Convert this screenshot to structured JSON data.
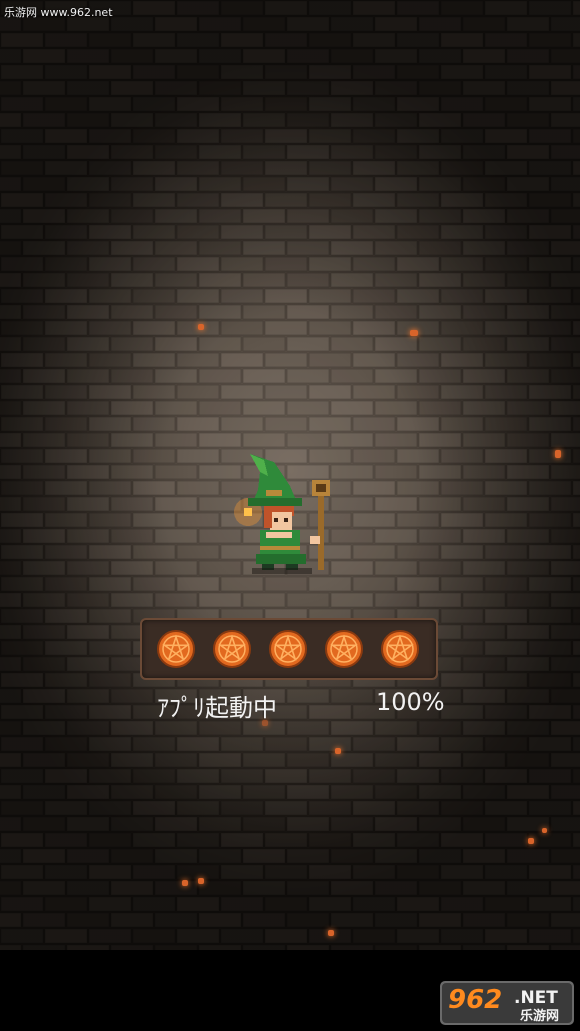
{
  "watermark": {
    "text": "乐游网 www.962.net"
  },
  "loading": {
    "label": "ｱﾌﾟﾘ起動中",
    "percent_text": "100%",
    "progress": 1.0,
    "slots_total": 5,
    "slots_filled": 5
  },
  "logo": {
    "number": "962",
    "suffix": ".NET",
    "subtitle": "乐游网"
  },
  "icons": {
    "character": "green-witch-with-staff-icon",
    "slot": "pentagram-icon"
  },
  "colors": {
    "pentagram_fill": "#e2691f",
    "pentagram_line": "#ffb060",
    "panel_border": "#6b4a36"
  }
}
